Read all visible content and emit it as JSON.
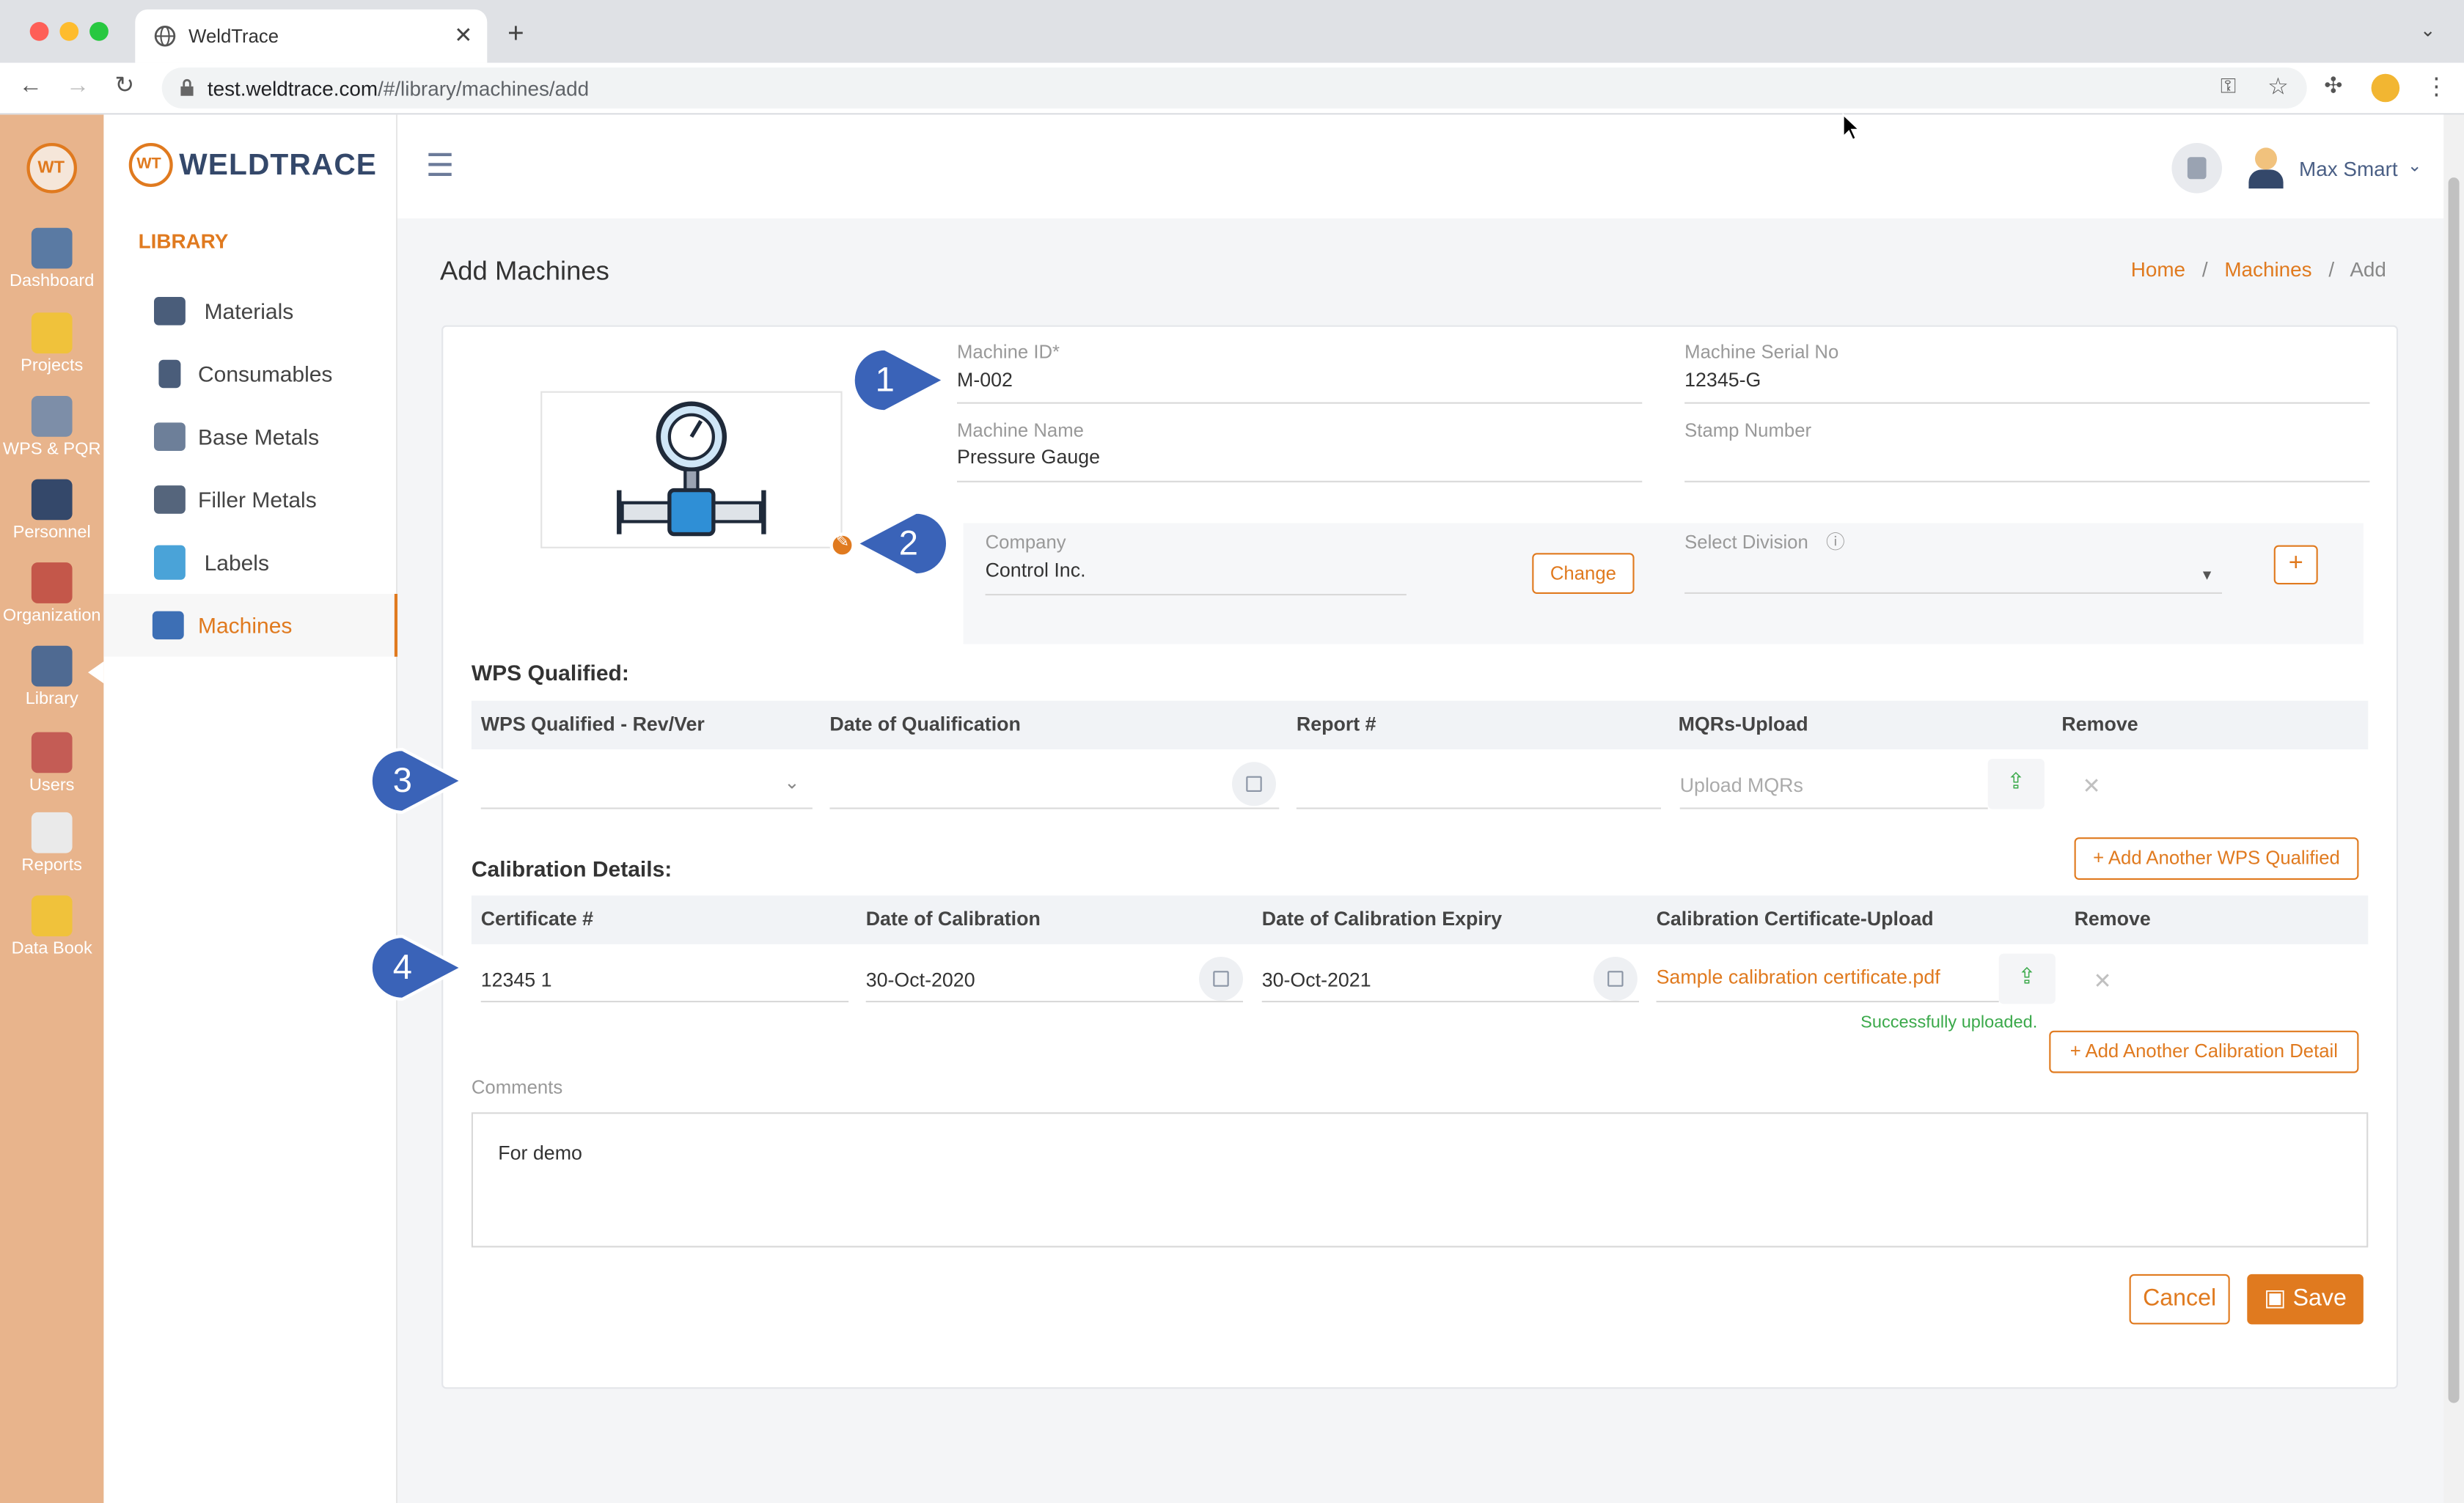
{
  "browser": {
    "tab_title": "WeldTrace",
    "url_host": "test.weldtrace.com",
    "url_path": "/#/library/machines/add"
  },
  "rail": {
    "items": [
      {
        "label": "Dashboard"
      },
      {
        "label": "Projects"
      },
      {
        "label": "WPS & PQR"
      },
      {
        "label": "Personnel"
      },
      {
        "label": "Organization"
      },
      {
        "label": "Library"
      },
      {
        "label": "Users"
      },
      {
        "label": "Reports"
      },
      {
        "label": "Data Book"
      }
    ]
  },
  "brand": {
    "mark": "WT",
    "name": "WELDTRACE"
  },
  "sidebar": {
    "section": "LIBRARY",
    "items": [
      {
        "label": "Materials"
      },
      {
        "label": "Consumables"
      },
      {
        "label": "Base Metals"
      },
      {
        "label": "Filler Metals"
      },
      {
        "label": "Labels"
      },
      {
        "label": "Machines"
      }
    ],
    "active": "Machines"
  },
  "header": {
    "user_name": "Max Smart"
  },
  "page": {
    "title": "Add Machines",
    "breadcrumb": {
      "home": "Home",
      "section": "Machines",
      "current": "Add"
    }
  },
  "form": {
    "machine_id": {
      "label": "Machine ID*",
      "value": "M-002"
    },
    "serial_no": {
      "label": "Machine Serial No",
      "value": "12345-G"
    },
    "machine_name": {
      "label": "Machine Name",
      "value": "Pressure Gauge"
    },
    "stamp_number": {
      "label": "Stamp Number",
      "value": ""
    },
    "company": {
      "label": "Company",
      "value": "Control Inc.",
      "change_label": "Change"
    },
    "division": {
      "label": "Select Division",
      "value": ""
    }
  },
  "wps": {
    "title": "WPS Qualified:",
    "headers": [
      "WPS Qualified - Rev/Ver",
      "Date of Qualification",
      "Report #",
      "MQRs-Upload",
      "Remove"
    ],
    "upload_placeholder": "Upload MQRs",
    "add_label": "Add Another WPS Qualified"
  },
  "calibration": {
    "title": "Calibration Details:",
    "headers": [
      "Certificate #",
      "Date of Calibration",
      "Date of Calibration Expiry",
      "Calibration Certificate-Upload",
      "Remove"
    ],
    "row": {
      "certificate": "12345 1",
      "date": "30-Oct-2020",
      "expiry": "30-Oct-2021",
      "file": "Sample calibration certificate.pdf"
    },
    "status": "Successfully uploaded.",
    "add_label": "Add Another Calibration Detail"
  },
  "comments": {
    "label": "Comments",
    "value": "For demo"
  },
  "actions": {
    "cancel": "Cancel",
    "save": "Save"
  },
  "callouts": [
    "1",
    "2",
    "3",
    "4"
  ],
  "colors": {
    "accent": "#e07a1f",
    "rail": "#e8b48c",
    "callout": "#3a63b8",
    "success": "#3aa94a"
  }
}
